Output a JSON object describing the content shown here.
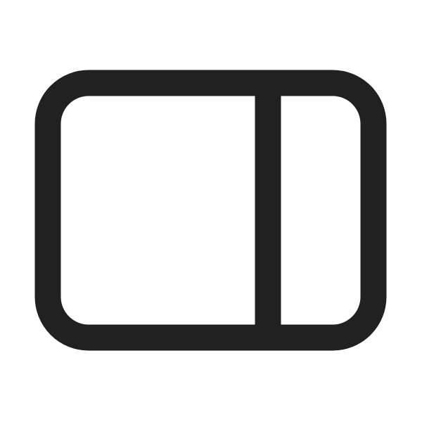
{
  "icon": {
    "name": "panel-right-icon",
    "stroke_color": "#212121",
    "background_color": "#ffffff"
  }
}
